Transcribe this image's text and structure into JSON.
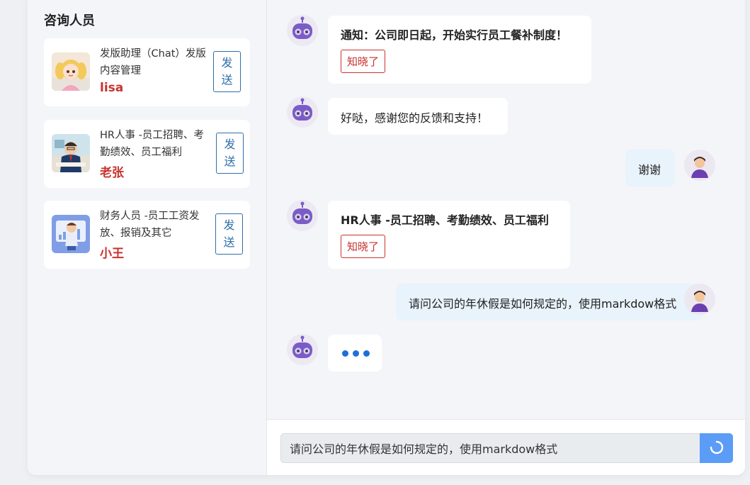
{
  "sidebar": {
    "title": "咨询人员",
    "contacts": [
      {
        "desc": "发版助理（Chat）发版内容管理",
        "name": "lisa",
        "send": "发送"
      },
      {
        "desc": "HR人事 -员工招聘、考勤绩效、员工福利",
        "name": "老张",
        "send": "发送"
      },
      {
        "desc": "财务人员 -员工工资发放、报销及其它",
        "name": "小王",
        "send": "发送"
      }
    ]
  },
  "messages": [
    {
      "role": "bot",
      "text": "通知：公司即日起，开始实行员工餐补制度！",
      "button": "知晓了"
    },
    {
      "role": "bot",
      "text": "好哒，感谢您的反馈和支持！"
    },
    {
      "role": "user",
      "text": "谢谢"
    },
    {
      "role": "bot",
      "text": "HR人事 -员工招聘、考勤绩效、员工福利",
      "button": "知晓了"
    },
    {
      "role": "user",
      "text": "请问公司的年休假是如何规定的，使用markdow格式"
    },
    {
      "role": "bot",
      "text": "…",
      "typing": true
    }
  ],
  "input": {
    "value": "请问公司的年休假是如何规定的，使用markdow格式",
    "submit_icon": "loading-spinner-icon"
  },
  "colors": {
    "accent_red": "#c8332f",
    "send_blue": "#2f6fa9",
    "submit_blue": "#5b9cf6",
    "bot_purple": "#7b5cc7"
  }
}
